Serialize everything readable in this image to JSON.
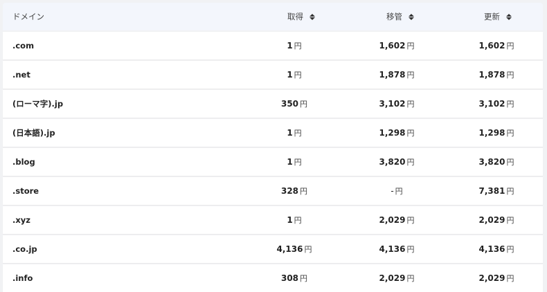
{
  "header": {
    "domain": "ドメイン",
    "acquire": "取得",
    "transfer": "移管",
    "renew": "更新"
  },
  "currency": "円",
  "rows": [
    {
      "domain": ".com",
      "acquire": "1",
      "transfer": "1,602",
      "renew": "1,602"
    },
    {
      "domain": ".net",
      "acquire": "1",
      "transfer": "1,878",
      "renew": "1,878"
    },
    {
      "domain": "(ローマ字).jp",
      "acquire": "350",
      "transfer": "3,102",
      "renew": "3,102"
    },
    {
      "domain": "(日本語).jp",
      "acquire": "1",
      "transfer": "1,298",
      "renew": "1,298"
    },
    {
      "domain": ".blog",
      "acquire": "1",
      "transfer": "3,820",
      "renew": "3,820"
    },
    {
      "domain": ".store",
      "acquire": "328",
      "transfer": "-",
      "renew": "7,381"
    },
    {
      "domain": ".xyz",
      "acquire": "1",
      "transfer": "2,029",
      "renew": "2,029"
    },
    {
      "domain": ".co.jp",
      "acquire": "4,136",
      "transfer": "4,136",
      "renew": "4,136"
    },
    {
      "domain": ".info",
      "acquire": "308",
      "transfer": "2,029",
      "renew": "2,029"
    }
  ]
}
